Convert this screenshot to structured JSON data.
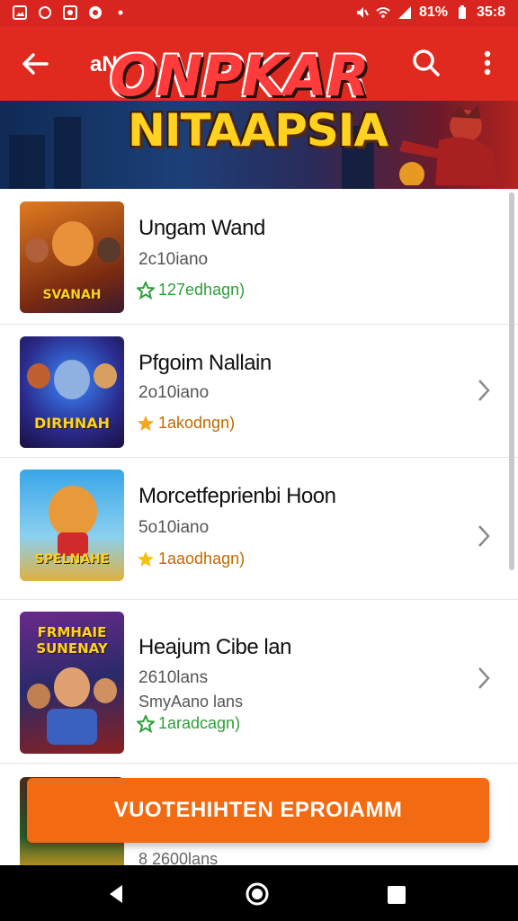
{
  "status_bar": {
    "battery": "81%",
    "time": "35:8"
  },
  "app_bar": {
    "short_title": "aN"
  },
  "banner": {
    "logo_line1": "ONPKAR",
    "logo_line2": "NITAAPSIA"
  },
  "games": [
    {
      "title": "Ungam Wand",
      "subtitle": "2c10iano",
      "rating": "127edhagn)",
      "rating_color": "green",
      "thumb_text": "SVANAH",
      "has_chevron": false
    },
    {
      "title": "Pfgoim Nallain",
      "subtitle": "2o10iano",
      "rating": "1akodngn)",
      "rating_color": "orange",
      "thumb_text": "DIRHNAH",
      "has_chevron": true
    },
    {
      "title": "Morcetfeprienbi Hoon",
      "subtitle": "5o10iano",
      "rating": "1aaodhagn)",
      "rating_color": "orange",
      "thumb_text": "SPELNAHE",
      "has_chevron": true
    },
    {
      "title": "Heajum Cibe lan",
      "subtitle": "2610lans",
      "subtitle2": "SmyAano lans",
      "rating": "1aradcagn)",
      "rating_color": "green",
      "thumb_text": "FRMHAIE SUNENAY",
      "has_chevron": true
    }
  ],
  "partial_row": {
    "subtitle": "8 2600lans"
  },
  "cta": {
    "label": "VUOTEHIHTEN EPROIAMM"
  },
  "colors": {
    "primary": "#e02a20",
    "cta": "#f26a12",
    "rating_green": "#2e9e3a",
    "rating_orange": "#c26a00"
  },
  "icons": {
    "back": "arrow-left-icon",
    "search": "search-icon",
    "more": "more-vertical-icon",
    "star": "star-icon",
    "chevron": "chevron-right-icon"
  }
}
